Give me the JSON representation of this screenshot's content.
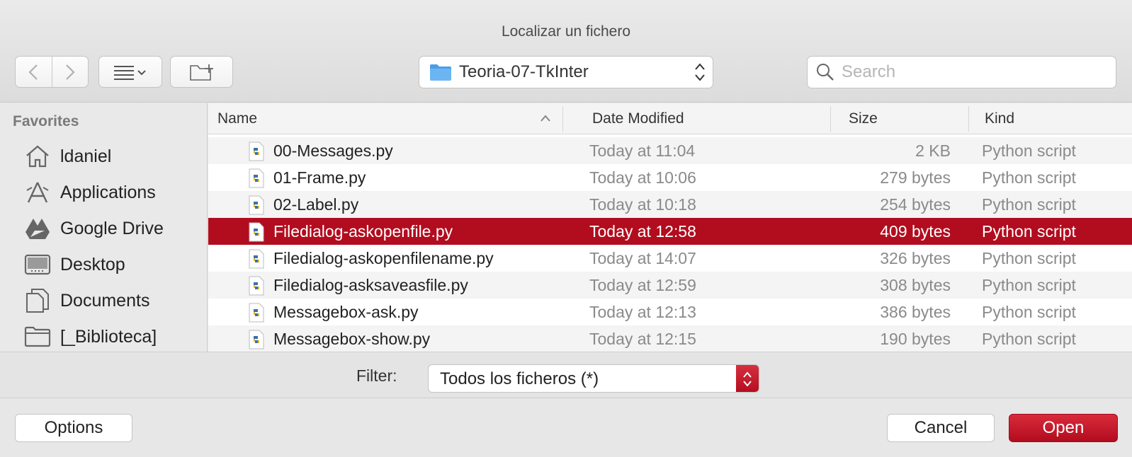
{
  "window": {
    "title": "Localizar un fichero"
  },
  "toolbar": {
    "back_icon": "chevron-left-icon",
    "forward_icon": "chevron-right-icon",
    "view_icon": "list-view-icon",
    "new_folder_icon": "new-folder-icon",
    "path": "Teoria-07-TkInter",
    "search_placeholder": "Search"
  },
  "sidebar": {
    "section": "Favorites",
    "items": [
      {
        "label": "ldaniel",
        "icon": "home-icon"
      },
      {
        "label": "Applications",
        "icon": "applications-icon"
      },
      {
        "label": "Google Drive",
        "icon": "google-drive-icon"
      },
      {
        "label": "Desktop",
        "icon": "desktop-icon"
      },
      {
        "label": "Documents",
        "icon": "documents-icon"
      },
      {
        "label": "[_Biblioteca]",
        "icon": "folder-icon"
      }
    ]
  },
  "filelist": {
    "columns": [
      "Name",
      "Date Modified",
      "Size",
      "Kind"
    ],
    "rows": [
      {
        "name": "00-Messages.py",
        "date": "Today at 11:04",
        "size": "2 KB",
        "kind": "Python script"
      },
      {
        "name": "01-Frame.py",
        "date": "Today at 10:06",
        "size": "279 bytes",
        "kind": "Python script"
      },
      {
        "name": "02-Label.py",
        "date": "Today at 10:18",
        "size": "254 bytes",
        "kind": "Python script"
      },
      {
        "name": "Filedialog-askopenfile.py",
        "date": "Today at 12:58",
        "size": "409 bytes",
        "kind": "Python script"
      },
      {
        "name": "Filedialog-askopenfilename.py",
        "date": "Today at 14:07",
        "size": "326 bytes",
        "kind": "Python script"
      },
      {
        "name": "Filedialog-asksaveasfile.py",
        "date": "Today at 12:59",
        "size": "308 bytes",
        "kind": "Python script"
      },
      {
        "name": "Messagebox-ask.py",
        "date": "Today at 12:13",
        "size": "386 bytes",
        "kind": "Python script"
      },
      {
        "name": "Messagebox-show.py",
        "date": "Today at 12:15",
        "size": "190 bytes",
        "kind": "Python script"
      }
    ],
    "selected_index": 3
  },
  "filter": {
    "label": "Filter:",
    "value": "Todos los ficheros (*)"
  },
  "buttons": {
    "options": "Options",
    "cancel": "Cancel",
    "open": "Open"
  },
  "colors": {
    "accent": "#b20c1f",
    "folder": "#4a9fe6"
  }
}
